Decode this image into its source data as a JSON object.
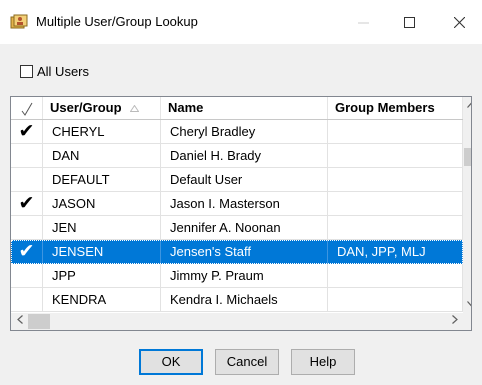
{
  "window": {
    "title": "Multiple User/Group Lookup"
  },
  "all_users": {
    "label": "All Users",
    "checked": false
  },
  "grid": {
    "columns": [
      "User/Group",
      "Name",
      "Group Members"
    ],
    "check_glyph": "✔",
    "rows": [
      {
        "check": "✔",
        "user": "CHERYL",
        "name": "Cheryl Bradley",
        "members": ""
      },
      {
        "check": "",
        "user": "DAN",
        "name": "Daniel H. Brady",
        "members": ""
      },
      {
        "check": "",
        "user": "DEFAULT",
        "name": "Default User",
        "members": ""
      },
      {
        "check": "✔",
        "user": "JASON",
        "name": "Jason I. Masterson",
        "members": ""
      },
      {
        "check": "",
        "user": "JEN",
        "name": "Jennifer A. Noonan",
        "members": ""
      },
      {
        "check": "✔",
        "user": "JENSEN",
        "name": "Jensen's Staff",
        "members": "DAN, JPP, MLJ"
      },
      {
        "check": "",
        "user": "JPP",
        "name": "Jimmy P. Praum",
        "members": ""
      },
      {
        "check": "",
        "user": "KENDRA",
        "name": "Kendra I. Michaels",
        "members": ""
      }
    ]
  },
  "buttons": {
    "ok": "OK",
    "cancel": "Cancel",
    "help": "Help"
  },
  "colors": {
    "selection": "#0078d7",
    "accent": "#0078d7"
  }
}
